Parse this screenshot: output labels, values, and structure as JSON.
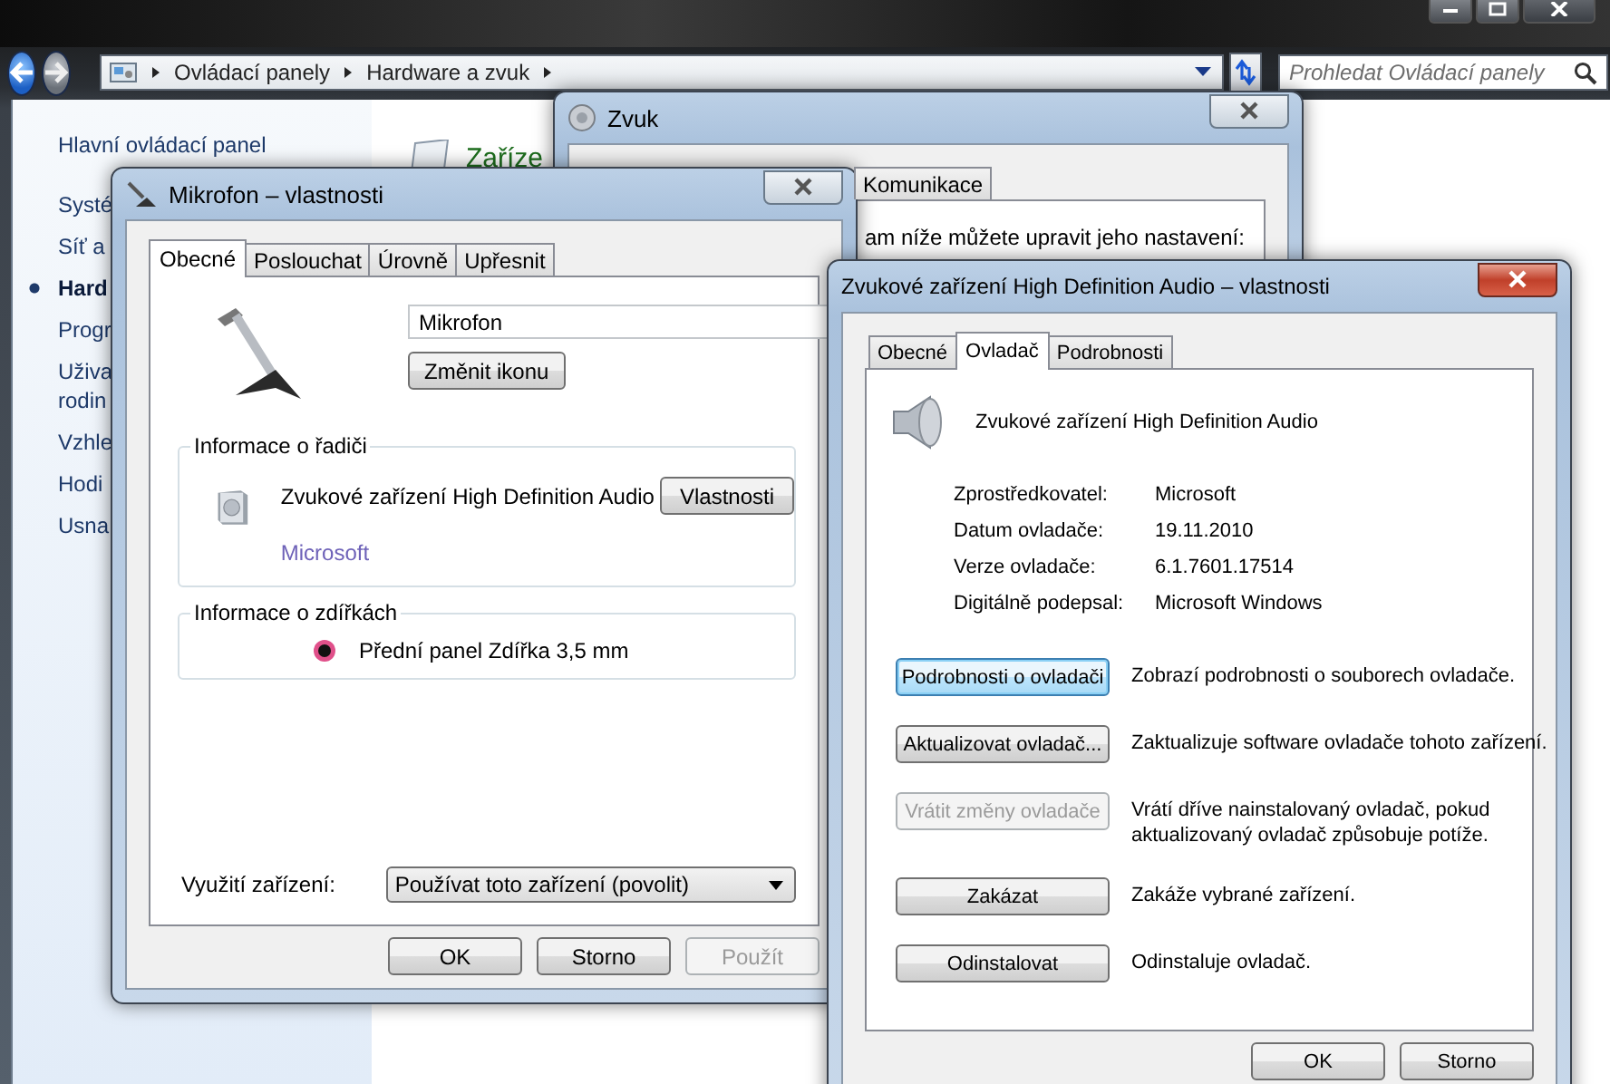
{
  "address_bar": {
    "breadcrumbs": [
      "Ovládací panely",
      "Hardware a zvuk"
    ],
    "search": {
      "placeholder": "Prohledat Ovládací panely"
    }
  },
  "nav": {
    "items": [
      {
        "lines": [
          "Hlavní ovládací panel"
        ],
        "selected": false
      },
      {
        "lines": [
          "Systé"
        ],
        "selected": false
      },
      {
        "lines": [
          "Síť a"
        ],
        "selected": false
      },
      {
        "lines": [
          "Hard"
        ],
        "selected": true
      },
      {
        "lines": [
          "Progr"
        ],
        "selected": false
      },
      {
        "lines": [
          "Uživa",
          "rodin"
        ],
        "selected": false
      },
      {
        "lines": [
          "Vzhle"
        ],
        "selected": false
      },
      {
        "lines": [
          "Hodi"
        ],
        "selected": false
      },
      {
        "lines": [
          "Usna"
        ],
        "selected": false
      }
    ]
  },
  "content": {
    "heading": "Zaříze"
  },
  "sound_window": {
    "title": "Zvuk",
    "tabs": [
      {
        "label": "Komunikace",
        "selected": false
      }
    ],
    "text": "am níže můžete upravit jeho nastavení:"
  },
  "mic_dialog": {
    "title": "Mikrofon – vlastnosti",
    "tabs": [
      {
        "label": "Obecné",
        "selected": true
      },
      {
        "label": "Poslouchat",
        "selected": false
      },
      {
        "label": "Úrovně",
        "selected": false
      },
      {
        "label": "Upřesnit",
        "selected": false
      }
    ],
    "name_field": "Mikrofon",
    "change_icon_button": "Změnit ikonu",
    "controller_group": {
      "title": "Informace o řadiči",
      "device": "Zvukové zařízení High Definition Audio",
      "button": "Vlastnosti",
      "manufacturer": "Microsoft"
    },
    "jack_group": {
      "title": "Informace o zdířkách",
      "jack": "Přední panel Zdířka 3,5 mm",
      "color": "#e0508a"
    },
    "usage": {
      "label": "Využití zařízení:",
      "value": "Používat toto zařízení (povolit)"
    },
    "buttons": [
      {
        "label": "OK",
        "disabled": false
      },
      {
        "label": "Storno",
        "disabled": false
      },
      {
        "label": "Použít",
        "disabled": true
      }
    ]
  },
  "driver_dialog": {
    "title": "Zvukové zařízení High Definition Audio – vlastnosti",
    "tabs": [
      {
        "label": "Obecné",
        "selected": false
      },
      {
        "label": "Ovladač",
        "selected": true
      },
      {
        "label": "Podrobnosti",
        "selected": false
      }
    ],
    "device": "Zvukové zařízení High Definition Audio",
    "properties": [
      {
        "label": "Zprostředkovatel:",
        "value": "Microsoft"
      },
      {
        "label": "Datum ovladače:",
        "value": "19.11.2010"
      },
      {
        "label": "Verze ovladače:",
        "value": "6.1.7601.17514"
      },
      {
        "label": "Digitálně podepsal:",
        "value": "Microsoft Windows"
      }
    ],
    "actions": [
      {
        "label": "Podrobnosti o ovladači",
        "description": "Zobrazí podrobnosti o souborech ovladače.",
        "disabled": false,
        "focused": true
      },
      {
        "label": "Aktualizovat ovladač...",
        "description": "Zaktualizuje software ovladače tohoto zařízení.",
        "disabled": false,
        "focused": false
      },
      {
        "label": "Vrátit změny ovladače",
        "description": "Vrátí dříve nainstalovaný ovladač, pokud aktualizovaný ovladač způsobuje potíže.",
        "disabled": true,
        "focused": false
      },
      {
        "label": "Zakázat",
        "description": "Zakáže vybrané zařízení.",
        "disabled": false,
        "focused": false
      },
      {
        "label": "Odinstalovat",
        "description": "Odinstaluje ovladač.",
        "disabled": false,
        "focused": false
      }
    ],
    "buttons": [
      {
        "label": "OK",
        "disabled": false
      },
      {
        "label": "Storno",
        "disabled": false
      }
    ]
  }
}
